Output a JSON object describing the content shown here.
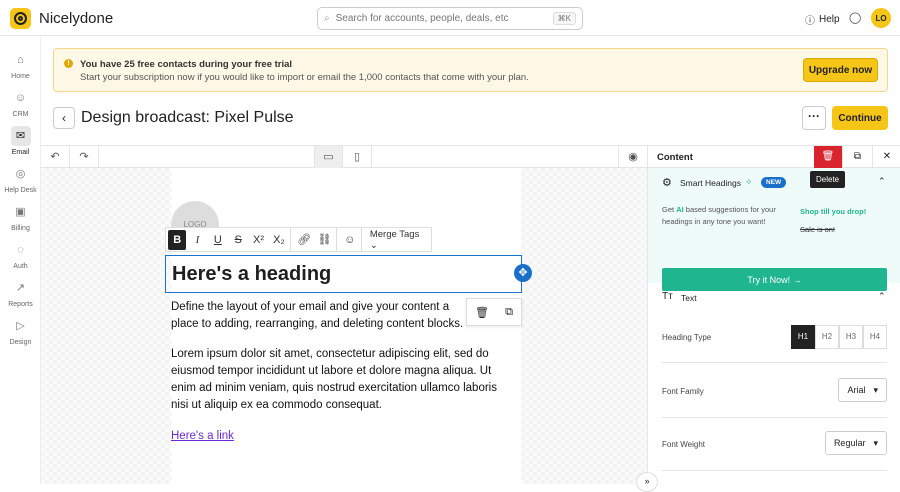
{
  "app": {
    "name": "Nicelydone"
  },
  "search": {
    "placeholder": "Search for accounts, people, deals, etc",
    "shortcut": "⌘K"
  },
  "header": {
    "help": "Help",
    "avatar": "LO"
  },
  "sidebar": {
    "items": [
      {
        "label": "Home",
        "icon": "⌂"
      },
      {
        "label": "CRM",
        "icon": "☺"
      },
      {
        "label": "Email",
        "icon": "✉"
      },
      {
        "label": "Help Desk",
        "icon": "◎"
      },
      {
        "label": "Billing",
        "icon": "▣"
      },
      {
        "label": "Auth",
        "icon": "◌"
      },
      {
        "label": "Reports",
        "icon": "↗"
      },
      {
        "label": "Design",
        "icon": "▷"
      }
    ]
  },
  "banner": {
    "title": "You have 25 free contacts during your free trial",
    "text": "Start your subscription now if you would like to import or email the 1,000 contacts that come with your plan.",
    "button": "Upgrade now"
  },
  "page": {
    "title": "Design broadcast: Pixel Pulse",
    "continue": "Continue"
  },
  "editor": {
    "logo": "LOGO",
    "merge_tags": "Merge Tags",
    "heading": "Here's a heading",
    "p1": "Define the layout of your email and give your content a place to adding, rearranging, and deleting content blocks.",
    "p2": "Lorem ipsum dolor sit amet, consectetur adipiscing elit, sed do eiusmod tempor incididunt ut labore et dolore magna aliqua. Ut enim ad minim veniam, quis nostrud exercitation ullamco laboris nisi ut aliquip ex ea commodo consequat.",
    "link": "Here's a link"
  },
  "panel": {
    "title": "Content",
    "delete_tooltip": "Delete",
    "smart": {
      "title": "Smart Headings",
      "badge": "NEW",
      "desc_pre": "Get ",
      "desc_ai": "AI",
      "desc_post": " based suggestions for your headings in any tone you want!",
      "sample1": "Shop till you drop!",
      "sample2": "Sale is on!",
      "button": "Try it Now! →"
    },
    "text_section": "Text",
    "heading_type": {
      "label": "Heading Type",
      "options": [
        "H1",
        "H2",
        "H3",
        "H4"
      ],
      "selected": "H1"
    },
    "font_family": {
      "label": "Font Family",
      "value": "Arial"
    },
    "font_weight": {
      "label": "Font Weight",
      "value": "Regular"
    }
  },
  "colors": {
    "accent": "#f5c518",
    "primary": "#1a73c9",
    "danger": "#d9232e",
    "green": "#1fb58f"
  }
}
